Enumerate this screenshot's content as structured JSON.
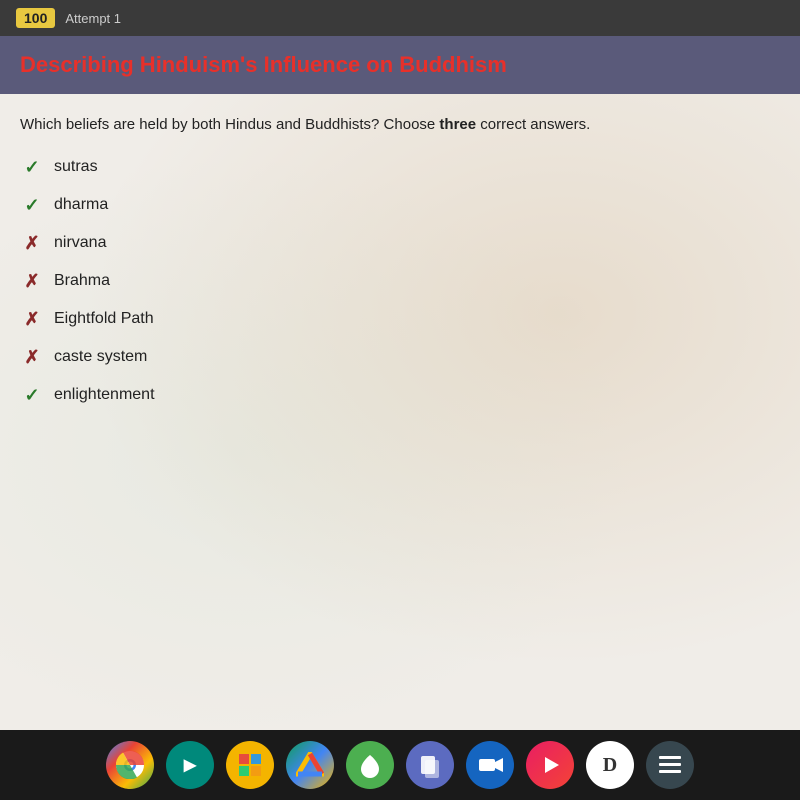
{
  "topBar": {
    "score": "100",
    "attemptLabel": "Attempt 1"
  },
  "titleBar": {
    "title": "Describing Hinduism's Influence on Buddhism"
  },
  "question": {
    "text": "Which beliefs are held by both Hindus and Buddhists? Choose",
    "boldWord": "three",
    "textAfter": "correct answers."
  },
  "answers": [
    {
      "label": "sutras",
      "correct": true
    },
    {
      "label": "dharma",
      "correct": true
    },
    {
      "label": "nirvana",
      "correct": false
    },
    {
      "label": "Brahma",
      "correct": false
    },
    {
      "label": "Eightfold Path",
      "correct": false
    },
    {
      "label": "caste system",
      "correct": false
    },
    {
      "label": "enlightenment",
      "correct": true
    }
  ],
  "taskbar": {
    "icons": [
      {
        "name": "chrome",
        "label": "Chrome"
      },
      {
        "name": "meet",
        "label": "Meet"
      },
      {
        "name": "slides",
        "label": "Slides"
      },
      {
        "name": "drive",
        "label": "Drive"
      },
      {
        "name": "green-app",
        "label": "Green App"
      },
      {
        "name": "files",
        "label": "Files"
      },
      {
        "name": "camera",
        "label": "Camera"
      },
      {
        "name": "play",
        "label": "Play"
      },
      {
        "name": "notion",
        "label": "Notion"
      },
      {
        "name": "menu",
        "label": "Menu"
      }
    ]
  }
}
